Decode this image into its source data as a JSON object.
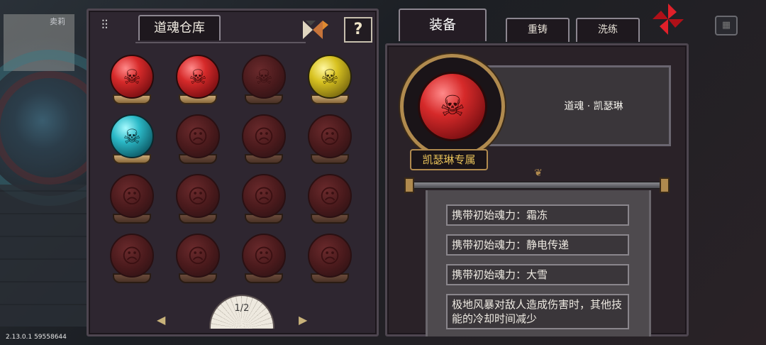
{
  "background": {
    "character_name": "卖莉",
    "version": "2.13.0.1 59558644"
  },
  "storage": {
    "title": "道魂仓库",
    "help_label": "?",
    "page": "1/2",
    "orbs": [
      {
        "style": "red",
        "state": "owned",
        "icon": "skull-icon"
      },
      {
        "style": "red",
        "state": "owned",
        "icon": "skull-icon"
      },
      {
        "style": "locked",
        "state": "locked",
        "icon": "skull-icon"
      },
      {
        "style": "gold",
        "state": "owned",
        "icon": "skull-icon"
      },
      {
        "style": "cyan",
        "state": "owned",
        "icon": "skull-icon"
      },
      {
        "style": "locked",
        "state": "locked",
        "icon": "face-icon"
      },
      {
        "style": "locked",
        "state": "locked",
        "icon": "face-icon"
      },
      {
        "style": "locked",
        "state": "locked",
        "icon": "face-icon"
      },
      {
        "style": "locked",
        "state": "locked",
        "icon": "face-icon"
      },
      {
        "style": "locked",
        "state": "locked",
        "icon": "face-icon"
      },
      {
        "style": "locked",
        "state": "locked",
        "icon": "face-icon"
      },
      {
        "style": "locked",
        "state": "locked",
        "icon": "face-icon"
      },
      {
        "style": "locked",
        "state": "locked",
        "icon": "face-icon"
      },
      {
        "style": "locked",
        "state": "locked",
        "icon": "face-icon"
      },
      {
        "style": "locked",
        "state": "locked",
        "icon": "face-icon"
      },
      {
        "style": "locked",
        "state": "locked",
        "icon": "face-icon"
      }
    ]
  },
  "tabs": {
    "equip": "装备",
    "recast": "重铸",
    "refine": "洗练"
  },
  "detail": {
    "soul_name": "道魂 · 凯瑟琳",
    "exclusive_label": "凯瑟琳专属",
    "attributes": [
      "携带初始魂力：霜冻",
      "携带初始魂力：静电传递",
      "携带初始魂力：大雪",
      "极地风暴对敌人造成伤害时，其他技能的冷却时间减少"
    ]
  },
  "colors": {
    "accent_gold": "#b08a4e",
    "orb_red": "#d62a2a",
    "orb_gold": "#d8c220",
    "orb_cyan": "#2bb9c7",
    "close_red": "#e0202a"
  }
}
